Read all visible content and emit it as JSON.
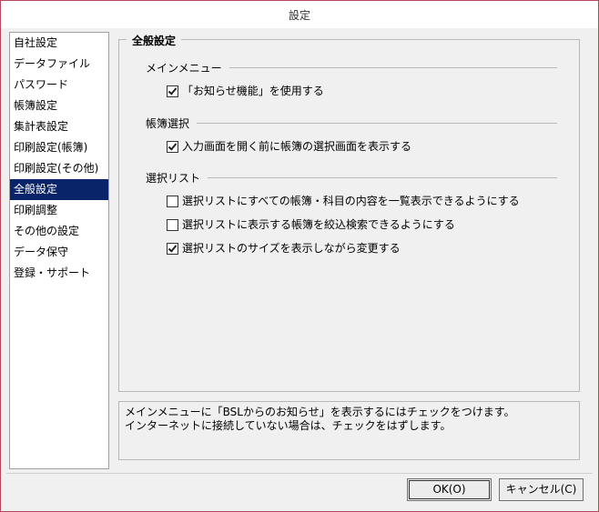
{
  "window": {
    "title": "設定"
  },
  "nav": {
    "items": [
      "自社設定",
      "データファイル",
      "パスワード",
      "帳簿設定",
      "集計表設定",
      "印刷設定(帳簿)",
      "印刷設定(その他)",
      "全般設定",
      "印刷調整",
      "その他の設定",
      "データ保守",
      "登録・サポート"
    ],
    "selected_index": 7
  },
  "panel": {
    "title": "全般設定",
    "sections": [
      {
        "label": "メインメニュー",
        "options": [
          {
            "label": "「お知らせ機能」を使用する",
            "checked": true
          }
        ]
      },
      {
        "label": "帳簿選択",
        "options": [
          {
            "label": "入力画面を開く前に帳簿の選択画面を表示する",
            "checked": true
          }
        ]
      },
      {
        "label": "選択リスト",
        "options": [
          {
            "label": "選択リストにすべての帳簿・科目の内容を一覧表示できるようにする",
            "checked": false
          },
          {
            "label": "選択リストに表示する帳簿を絞込検索できるようにする",
            "checked": false
          },
          {
            "label": "選択リストのサイズを表示しながら変更する",
            "checked": true
          }
        ]
      }
    ]
  },
  "description": {
    "line1": "メインメニューに「BSLからのお知らせ」を表示するにはチェックをつけます。",
    "line2": "インターネットに接続していない場合は、チェックをはずします。"
  },
  "buttons": {
    "ok": "OK(O)",
    "cancel": "キャンセル(C)"
  }
}
